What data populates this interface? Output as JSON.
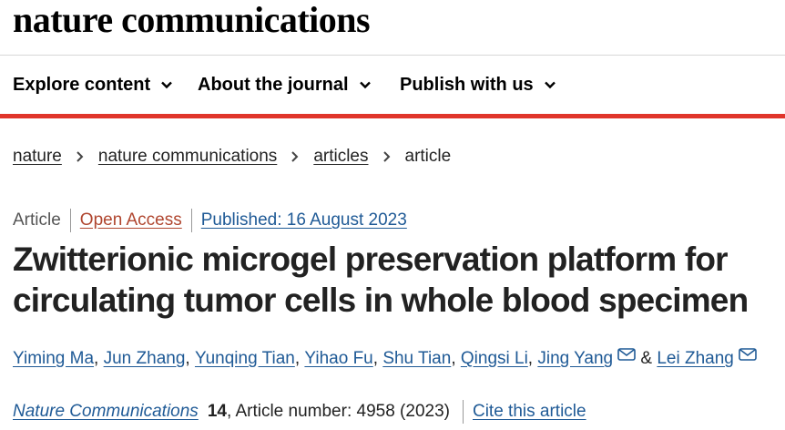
{
  "header": {
    "logo": "nature communications"
  },
  "nav": {
    "items": [
      {
        "label": "Explore content"
      },
      {
        "label": "About the journal"
      },
      {
        "label": "Publish with us"
      }
    ]
  },
  "breadcrumb": {
    "items": [
      "nature",
      "nature communications",
      "articles"
    ],
    "current": "article"
  },
  "article": {
    "type": "Article",
    "access": "Open Access",
    "published": "Published: 16 August 2023",
    "title": "Zwitterionic microgel preservation platform for circulating tumor cells in whole blood specimen",
    "authors": [
      "Yiming Ma",
      "Jun Zhang",
      "Yunqing Tian",
      "Yihao Fu",
      "Shu Tian",
      "Qingsi Li",
      "Jing Yang",
      "Lei Zhang"
    ],
    "author_separator": ", ",
    "last_author_separator": " & ",
    "journal": "Nature Communications",
    "volume": "14",
    "article_number": ", Article number: 4958 (2023)",
    "cite_label": "Cite this article"
  },
  "colors": {
    "accent_red": "#e0352b",
    "link_blue": "#1f5a96",
    "open_access": "#b0462f"
  },
  "icons": [
    "chevron-down-icon",
    "chevron-right-icon",
    "mail-icon"
  ]
}
